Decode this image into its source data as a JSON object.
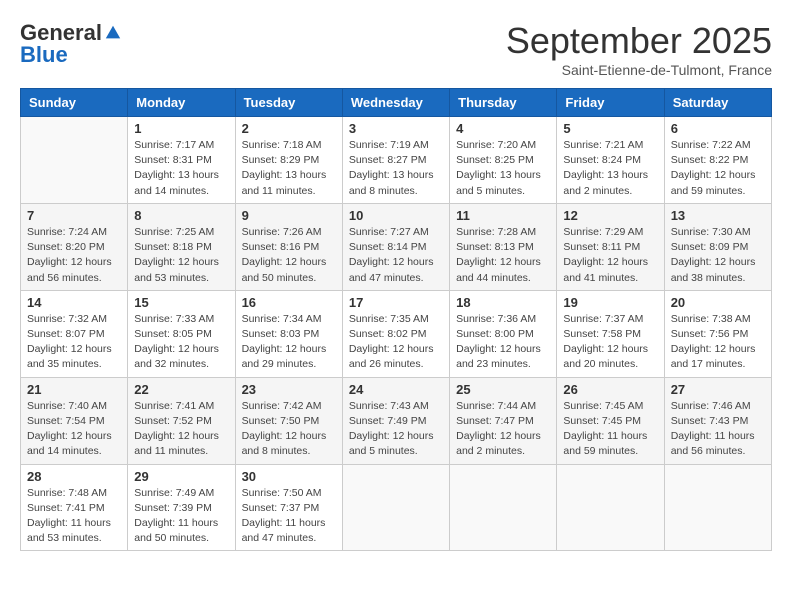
{
  "logo": {
    "general": "General",
    "blue": "Blue"
  },
  "title": "September 2025",
  "subtitle": "Saint-Etienne-de-Tulmont, France",
  "days_of_week": [
    "Sunday",
    "Monday",
    "Tuesday",
    "Wednesday",
    "Thursday",
    "Friday",
    "Saturday"
  ],
  "weeks": [
    [
      {
        "day": null
      },
      {
        "day": 1,
        "sunrise": "7:17 AM",
        "sunset": "8:31 PM",
        "daylight": "13 hours and 14 minutes."
      },
      {
        "day": 2,
        "sunrise": "7:18 AM",
        "sunset": "8:29 PM",
        "daylight": "13 hours and 11 minutes."
      },
      {
        "day": 3,
        "sunrise": "7:19 AM",
        "sunset": "8:27 PM",
        "daylight": "13 hours and 8 minutes."
      },
      {
        "day": 4,
        "sunrise": "7:20 AM",
        "sunset": "8:25 PM",
        "daylight": "13 hours and 5 minutes."
      },
      {
        "day": 5,
        "sunrise": "7:21 AM",
        "sunset": "8:24 PM",
        "daylight": "13 hours and 2 minutes."
      },
      {
        "day": 6,
        "sunrise": "7:22 AM",
        "sunset": "8:22 PM",
        "daylight": "12 hours and 59 minutes."
      }
    ],
    [
      {
        "day": 7,
        "sunrise": "7:24 AM",
        "sunset": "8:20 PM",
        "daylight": "12 hours and 56 minutes."
      },
      {
        "day": 8,
        "sunrise": "7:25 AM",
        "sunset": "8:18 PM",
        "daylight": "12 hours and 53 minutes."
      },
      {
        "day": 9,
        "sunrise": "7:26 AM",
        "sunset": "8:16 PM",
        "daylight": "12 hours and 50 minutes."
      },
      {
        "day": 10,
        "sunrise": "7:27 AM",
        "sunset": "8:14 PM",
        "daylight": "12 hours and 47 minutes."
      },
      {
        "day": 11,
        "sunrise": "7:28 AM",
        "sunset": "8:13 PM",
        "daylight": "12 hours and 44 minutes."
      },
      {
        "day": 12,
        "sunrise": "7:29 AM",
        "sunset": "8:11 PM",
        "daylight": "12 hours and 41 minutes."
      },
      {
        "day": 13,
        "sunrise": "7:30 AM",
        "sunset": "8:09 PM",
        "daylight": "12 hours and 38 minutes."
      }
    ],
    [
      {
        "day": 14,
        "sunrise": "7:32 AM",
        "sunset": "8:07 PM",
        "daylight": "12 hours and 35 minutes."
      },
      {
        "day": 15,
        "sunrise": "7:33 AM",
        "sunset": "8:05 PM",
        "daylight": "12 hours and 32 minutes."
      },
      {
        "day": 16,
        "sunrise": "7:34 AM",
        "sunset": "8:03 PM",
        "daylight": "12 hours and 29 minutes."
      },
      {
        "day": 17,
        "sunrise": "7:35 AM",
        "sunset": "8:02 PM",
        "daylight": "12 hours and 26 minutes."
      },
      {
        "day": 18,
        "sunrise": "7:36 AM",
        "sunset": "8:00 PM",
        "daylight": "12 hours and 23 minutes."
      },
      {
        "day": 19,
        "sunrise": "7:37 AM",
        "sunset": "7:58 PM",
        "daylight": "12 hours and 20 minutes."
      },
      {
        "day": 20,
        "sunrise": "7:38 AM",
        "sunset": "7:56 PM",
        "daylight": "12 hours and 17 minutes."
      }
    ],
    [
      {
        "day": 21,
        "sunrise": "7:40 AM",
        "sunset": "7:54 PM",
        "daylight": "12 hours and 14 minutes."
      },
      {
        "day": 22,
        "sunrise": "7:41 AM",
        "sunset": "7:52 PM",
        "daylight": "12 hours and 11 minutes."
      },
      {
        "day": 23,
        "sunrise": "7:42 AM",
        "sunset": "7:50 PM",
        "daylight": "12 hours and 8 minutes."
      },
      {
        "day": 24,
        "sunrise": "7:43 AM",
        "sunset": "7:49 PM",
        "daylight": "12 hours and 5 minutes."
      },
      {
        "day": 25,
        "sunrise": "7:44 AM",
        "sunset": "7:47 PM",
        "daylight": "12 hours and 2 minutes."
      },
      {
        "day": 26,
        "sunrise": "7:45 AM",
        "sunset": "7:45 PM",
        "daylight": "11 hours and 59 minutes."
      },
      {
        "day": 27,
        "sunrise": "7:46 AM",
        "sunset": "7:43 PM",
        "daylight": "11 hours and 56 minutes."
      }
    ],
    [
      {
        "day": 28,
        "sunrise": "7:48 AM",
        "sunset": "7:41 PM",
        "daylight": "11 hours and 53 minutes."
      },
      {
        "day": 29,
        "sunrise": "7:49 AM",
        "sunset": "7:39 PM",
        "daylight": "11 hours and 50 minutes."
      },
      {
        "day": 30,
        "sunrise": "7:50 AM",
        "sunset": "7:37 PM",
        "daylight": "11 hours and 47 minutes."
      },
      {
        "day": null
      },
      {
        "day": null
      },
      {
        "day": null
      },
      {
        "day": null
      }
    ]
  ],
  "labels": {
    "sunrise": "Sunrise:",
    "sunset": "Sunset:",
    "daylight": "Daylight:"
  }
}
